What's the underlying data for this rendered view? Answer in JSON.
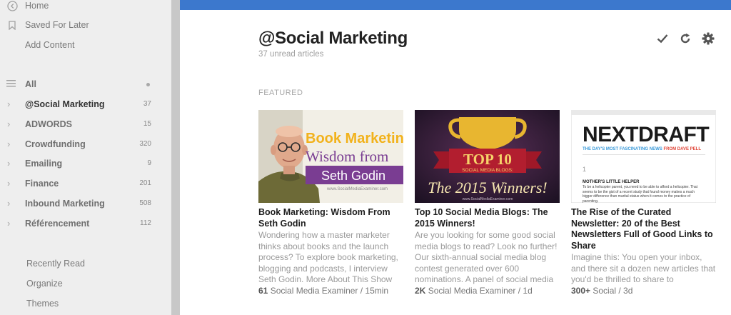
{
  "nav": {
    "home": "Home",
    "saved_for_later": "Saved For Later",
    "add_content": "Add Content",
    "all": "All"
  },
  "categories": [
    {
      "label": "@Social Marketing",
      "count": "37",
      "active": true
    },
    {
      "label": "ADWORDS",
      "count": "15"
    },
    {
      "label": "Crowdfunding",
      "count": "320"
    },
    {
      "label": "Emailing",
      "count": "9"
    },
    {
      "label": "Finance",
      "count": "201"
    },
    {
      "label": "Inbound Marketing",
      "count": "508"
    },
    {
      "label": "Référencement",
      "count": "112"
    }
  ],
  "bottom_nav": {
    "recently_read": "Recently Read",
    "organize": "Organize",
    "themes": "Themes"
  },
  "header": {
    "title": "@Social Marketing",
    "subtitle": "37 unread articles"
  },
  "section_label": "FEATURED",
  "articles": [
    {
      "title": "Book Marketing: Wisdom From Seth Godin",
      "summary": "Wondering how a master marketer thinks about books and the launch process? To explore book marketing, blogging and podcasts, I interview Seth Godin. More About This Show",
      "engagement": "61",
      "meta": "Social Media Examiner / 15min",
      "thumb": {
        "line1": "Book Marketing:",
        "line2": "Wisdom from",
        "line3": "Seth Godin",
        "url": "www.SocialMediaExaminer.com"
      }
    },
    {
      "title": "Top 10 Social Media Blogs: The 2015 Winners!",
      "summary": "Are you looking for some good social media blogs to read? Look no further! Our sixth-annual social media blog contest generated over 600 nominations. A panel of social media",
      "engagement": "2K",
      "meta": "Social Media Examiner / 1d",
      "thumb": {
        "line1": "TOP 10",
        "line2": "SOCIAL MEDIA BLOGS:",
        "line3": "The 2015 Winners!",
        "url": "www.SocialMediaExaminer.com"
      }
    },
    {
      "title": "The Rise of the Curated Newsletter: 20 of the Best Newsletters Full of Good Links to Share",
      "summary": "Imagine this: You open your inbox, and there sit a dozen new articles that you'd be thrilled to share to",
      "engagement": "300+",
      "meta": "Social / 3d",
      "thumb": {
        "brand": "NEXTDRAFT",
        "tagline_a": "THE DAY'S MOST FASCINATING NEWS ",
        "tagline_b": "FROM DAVE PELL",
        "num": "1",
        "heading": "MOTHER'S LITTLE HELPER",
        "body": "To be a helicopter parent, you need to be able to afford a helicopter. That seems to be the gist of a recent study that found money makes a much bigger difference than marital status when it comes to the practice of parenting."
      }
    }
  ],
  "colors": {
    "accent": "#3c78cd",
    "sidebar_bg": "#eeeeee",
    "godin_purple": "#7a3d92",
    "top10_red": "#a01828",
    "top10_gold": "#e8b630",
    "top10_bg": "#2a1a2e"
  }
}
